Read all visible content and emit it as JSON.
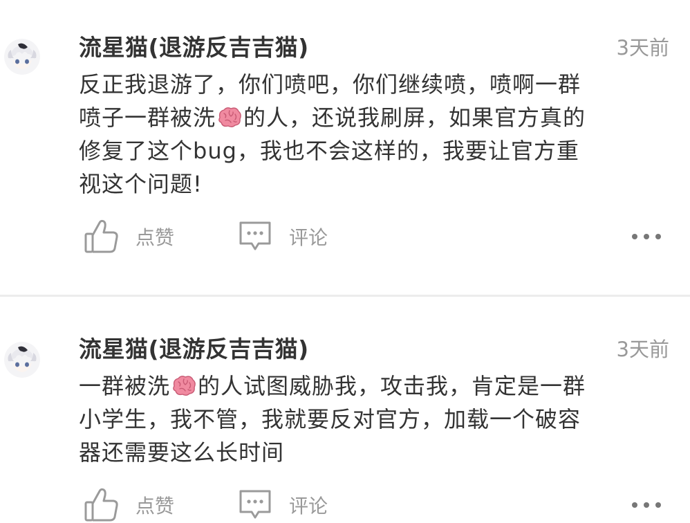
{
  "posts": [
    {
      "username": "流星猫(退游反吉吉猫)",
      "time": "3天前",
      "content_line_1": "反正我退游了，你们喷吧，你们继续喷，喷啊一群",
      "content_line_2a": "喷子一群被洗",
      "content_line_2b": "的人，还说我刷屏，如果官方真的",
      "content_line_3": "修复了这个bug，我也不会这样的，我要让官方重",
      "content_line_4": "视这个问题!",
      "like_label": "点赞",
      "comment_label": "评论"
    },
    {
      "username": "流星猫(退游反吉吉猫)",
      "time": "3天前",
      "content_line_1a": "一群被洗",
      "content_line_1b": "的人试图威胁我，攻击我，肯定是一群",
      "content_line_2": "小学生，我不管，我就要反对官方，加载一个破容",
      "content_line_3": "器还需要这么长时间",
      "like_label": "点赞",
      "comment_label": "评论"
    }
  ],
  "icons": {
    "avatar": "avatar-anime-cat",
    "emoji": "brain-emoji",
    "like": "thumbs-up-icon",
    "comment": "comment-bubble-icon",
    "more": "more-dots-icon"
  },
  "colors": {
    "username": "#333333",
    "content": "#333333",
    "muted": "#999999",
    "divider": "#ececec",
    "brain": "#f08aa0"
  }
}
